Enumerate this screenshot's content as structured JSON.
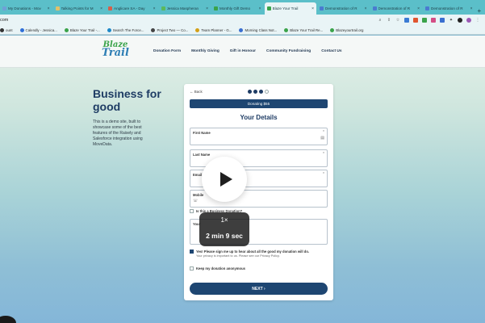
{
  "browser": {
    "tabs": [
      {
        "label": "My Donations - Mov",
        "color": "#6fa1d6"
      },
      {
        "label": "Talking Points for M",
        "color": "#e1c16a"
      },
      {
        "label": "Anglicare SA - Day",
        "color": "#d65f4a"
      },
      {
        "label": "Jessica Maspheran",
        "color": "#5cb85c"
      },
      {
        "label": "Monthly Gift Demo",
        "color": "#3aa34a"
      },
      {
        "label": "Blaze Your Trail",
        "color": "#3aa34a",
        "active": true
      },
      {
        "label": "Demonstration of R",
        "color": "#4a7bd0"
      },
      {
        "label": "Demonstration of R",
        "color": "#4a7bd0"
      },
      {
        "label": "Demonstration of R",
        "color": "#4a7bd0"
      }
    ],
    "url": "com",
    "bookmarks": [
      {
        "label": "ount",
        "color": "#333333"
      },
      {
        "label": "Calendly - Jessica...",
        "color": "#2f6fd8"
      },
      {
        "label": "Blaze Your Trail -...",
        "color": "#3aa34a"
      },
      {
        "label": "Search The Force...",
        "color": "#1e88c8"
      },
      {
        "label": "Project Two — Co...",
        "color": "#444444"
      },
      {
        "label": "Team Planner - G...",
        "color": "#d4a017"
      },
      {
        "label": "Morning Class Not...",
        "color": "#3a6fd0"
      },
      {
        "label": "Blaze Your Trail Re...",
        "color": "#3aa34a"
      },
      {
        "label": "Blazeyourtrail.org",
        "color": "#3aa34a"
      }
    ]
  },
  "site": {
    "logo_line1": "Blaze",
    "logo_line2": "Trail",
    "nav": [
      "Donation Form",
      "Monthly Giving",
      "Gift in Honour",
      "Community Fundraising",
      "Contact Us"
    ],
    "hero_title": "Business for good",
    "hero_text": "This is a demo site, built to showcase some of the best features of the Raisely and Salesforce integration using MoveData."
  },
  "form": {
    "back_label": "Back",
    "donating_label": "Donating $55",
    "title": "Your Details",
    "first_name_label": "First Name",
    "last_name_label": "Last Name",
    "email_label": "Email",
    "mobile_label": "Mobile",
    "business_donation_label": "Is this a Business Donation?",
    "message_label": "Your",
    "consent_label": "Yes! Please sign me up to hear about all the good my donation will do.",
    "privacy_text": "Your privacy is important to us. Please see our Privacy Policy.",
    "anonymous_label": "Keep my donation anonymous",
    "next_label": "NEXT  ›",
    "required_mark": "*"
  },
  "video": {
    "speed": "1×",
    "duration": "2 min 9 sec"
  }
}
